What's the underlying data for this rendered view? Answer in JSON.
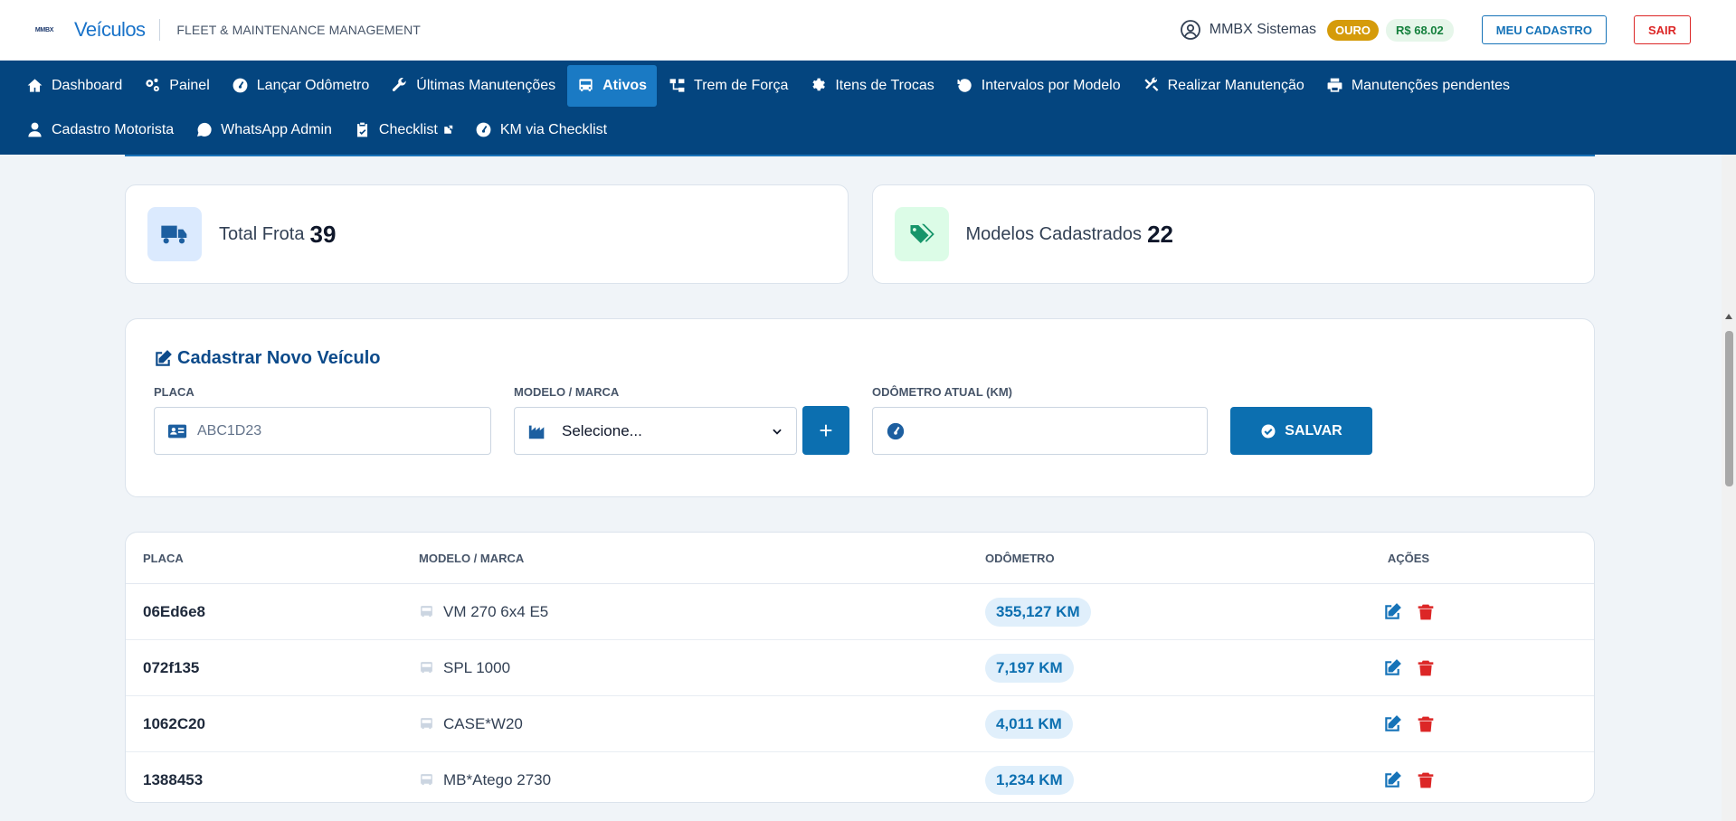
{
  "header": {
    "logo_text": "MMBX",
    "app_name": "Veículos",
    "subtitle": "FLEET & MAINTENANCE MANAGEMENT",
    "user_name": "MMBX Sistemas",
    "plan_badge": "OURO",
    "balance": "R$ 68.02",
    "profile_button": "MEU CADASTRO",
    "logout_button": "SAIR"
  },
  "nav": {
    "row1": [
      {
        "label": "Dashboard",
        "icon": "home-icon"
      },
      {
        "label": "Painel",
        "icon": "cogs-icon"
      },
      {
        "label": "Lançar Odômetro",
        "icon": "gauge-icon"
      },
      {
        "label": "Últimas Manutenções",
        "icon": "wrench-icon"
      },
      {
        "label": "Ativos",
        "icon": "bus-icon",
        "active": true
      },
      {
        "label": "Trem de Força",
        "icon": "sitemap-icon"
      },
      {
        "label": "Itens de Trocas",
        "icon": "gear-icon"
      },
      {
        "label": "Intervalos por Modelo",
        "icon": "history-icon"
      },
      {
        "label": "Realizar Manutenção",
        "icon": "tools-icon"
      },
      {
        "label": "Manutenções pendentes",
        "icon": "print-icon"
      }
    ],
    "row2": [
      {
        "label": "Cadastro Motorista",
        "icon": "user-icon"
      },
      {
        "label": "WhatsApp Admin",
        "icon": "whatsapp-icon"
      },
      {
        "label": "Checklist",
        "icon": "clipboard-check-icon",
        "external": true
      },
      {
        "label": "KM via Checklist",
        "icon": "gauge-icon"
      }
    ]
  },
  "stats": {
    "total_label": "Total Frota",
    "total_value": "39",
    "models_label": "Modelos Cadastrados",
    "models_value": "22"
  },
  "form": {
    "title": "Cadastrar Novo Veículo",
    "plate_label": "PLACA",
    "plate_placeholder": "ABC1D23",
    "model_label": "MODELO / MARCA",
    "model_selected": "Selecione...",
    "add_button": "+",
    "odometer_label": "ODÔMETRO ATUAL (KM)",
    "odometer_value": "",
    "save_button": "SALVAR"
  },
  "table": {
    "headers": [
      "PLACA",
      "MODELO / MARCA",
      "ODÔMETRO",
      "AÇÕES"
    ],
    "rows": [
      {
        "plate": "06Ed6e8",
        "model": "VM 270 6x4 E5",
        "odometer": "355,127 KM"
      },
      {
        "plate": "072f135",
        "model": "SPL 1000",
        "odometer": "7,197 KM"
      },
      {
        "plate": "1062C20",
        "model": "CASE*W20",
        "odometer": "4,011 KM"
      },
      {
        "plate": "1388453",
        "model": "MB*Atego 2730",
        "odometer": "1,234 KM"
      }
    ]
  },
  "colors": {
    "nav_bg": "#04457f",
    "nav_active": "#1a7ac4",
    "primary": "#0c6fb0",
    "danger": "#dc2626",
    "gold": "#d59b0a"
  }
}
